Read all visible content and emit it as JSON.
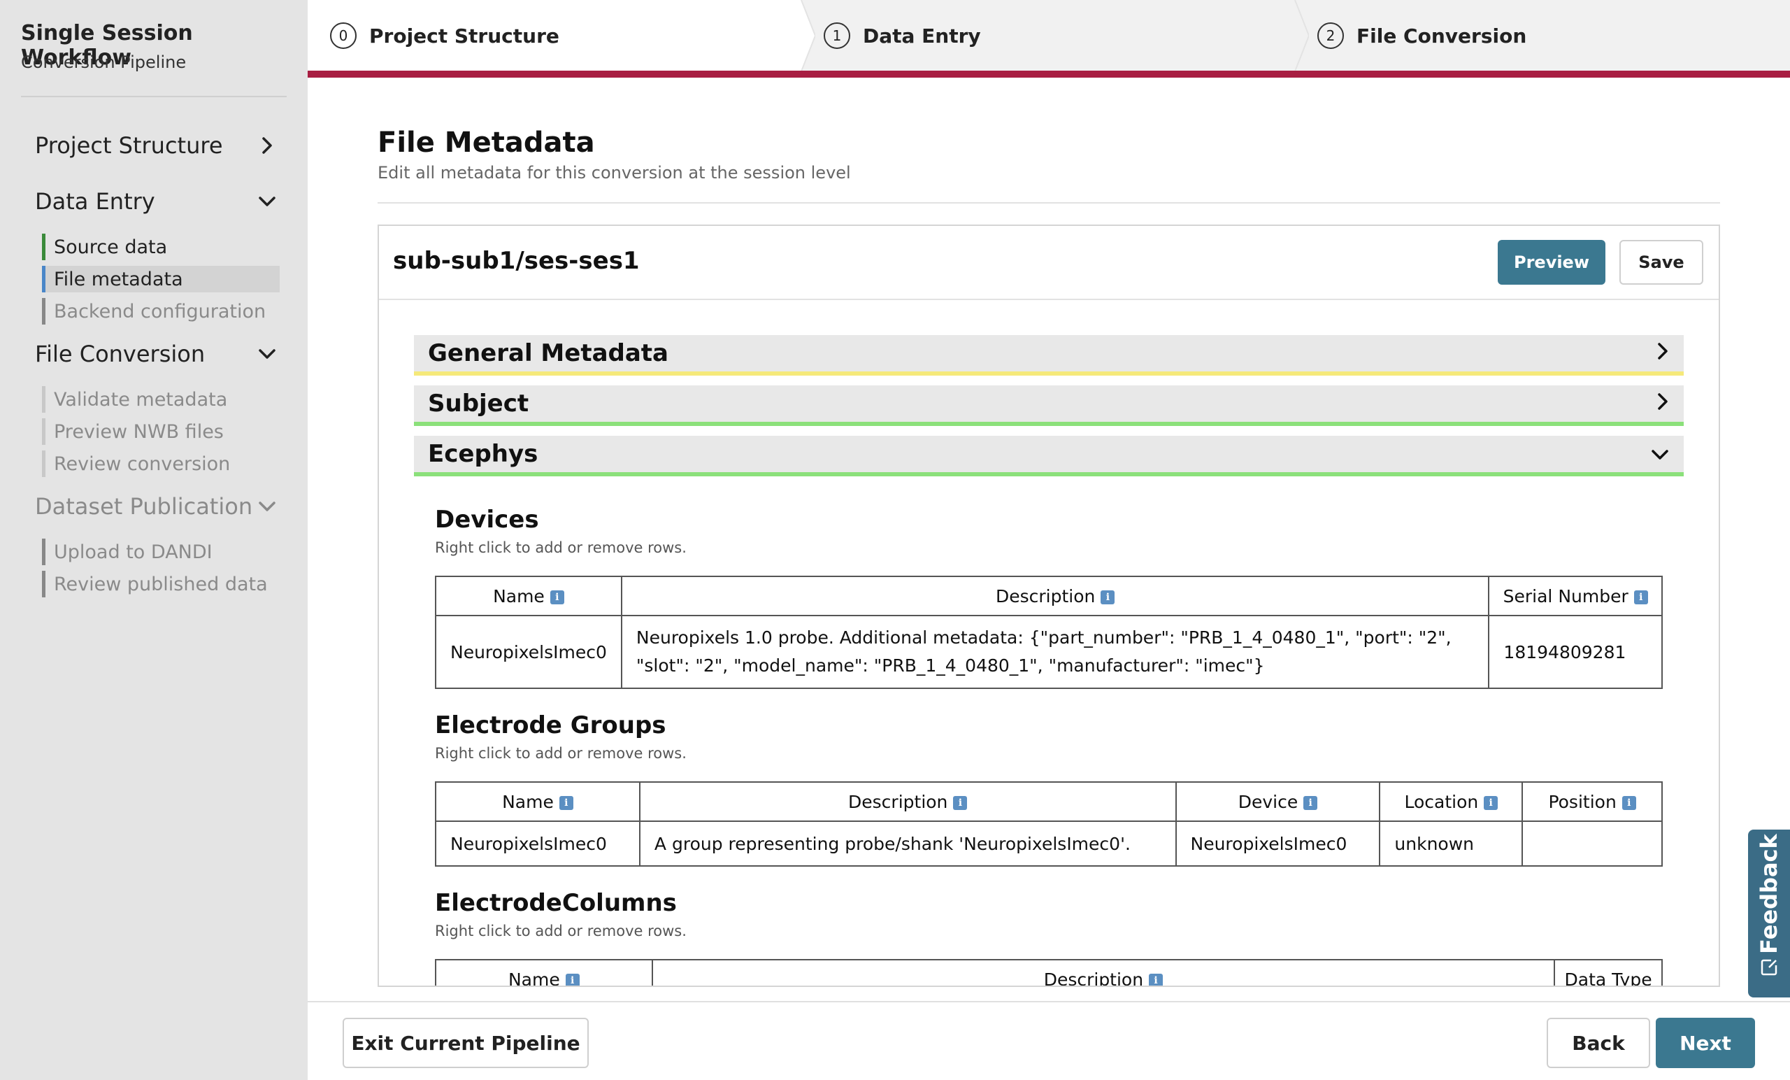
{
  "sidebar": {
    "title": "Single Session Workflow",
    "subtitle": "Conversion Pipeline",
    "sections": [
      {
        "label": "Project Structure",
        "items": []
      },
      {
        "label": "Data Entry",
        "items": [
          "Source data",
          "File metadata",
          "Backend configuration"
        ]
      },
      {
        "label": "File Conversion",
        "items": [
          "Validate metadata",
          "Preview NWB files",
          "Review conversion"
        ]
      },
      {
        "label": "Dataset Publication",
        "items": [
          "Upload to DANDI",
          "Review published data"
        ]
      }
    ]
  },
  "stepper": {
    "steps": [
      {
        "num": "0",
        "label": "Project Structure"
      },
      {
        "num": "1",
        "label": "Data Entry"
      },
      {
        "num": "2",
        "label": "File Conversion"
      }
    ],
    "accent_color": "#a81e42"
  },
  "page": {
    "title": "File Metadata",
    "subtitle": "Edit all metadata for this conversion at the session level"
  },
  "session": {
    "name": "sub-sub1/ses-ses1",
    "preview_label": "Preview",
    "save_label": "Save"
  },
  "accordion": {
    "general": "General Metadata",
    "subject": "Subject",
    "ecephys": "Ecephys"
  },
  "hint": "Right click to add or remove rows.",
  "devices": {
    "title": "Devices",
    "headers": [
      "Name",
      "Description",
      "Serial Number"
    ],
    "rows": [
      {
        "name": "NeuropixelsImec0",
        "description": "Neuropixels 1.0 probe. Additional metadata: {\"part_number\": \"PRB_1_4_0480_1\", \"port\": \"2\", \"slot\": \"2\", \"model_name\": \"PRB_1_4_0480_1\", \"manufacturer\": \"imec\"}",
        "serial": "18194809281"
      }
    ]
  },
  "electrode_groups": {
    "title": "Electrode Groups",
    "headers": [
      "Name",
      "Description",
      "Device",
      "Location",
      "Position"
    ],
    "rows": [
      {
        "name": "NeuropixelsImec0",
        "description": "A group representing probe/shank 'NeuropixelsImec0'.",
        "device": "NeuropixelsImec0",
        "location": "unknown",
        "position": ""
      }
    ]
  },
  "electrode_columns": {
    "title": "ElectrodeColumns",
    "headers": [
      "Name",
      "Description",
      "Data Type"
    ]
  },
  "footer": {
    "exit_label": "Exit Current Pipeline",
    "back_label": "Back",
    "next_label": "Next"
  },
  "feedback": {
    "label": "Feedback"
  },
  "colors": {
    "primary": "#3b7890",
    "yellow_accent": "#f5e97a",
    "green_accent": "#8be07a",
    "feedback_bg": "#3b6c86"
  }
}
